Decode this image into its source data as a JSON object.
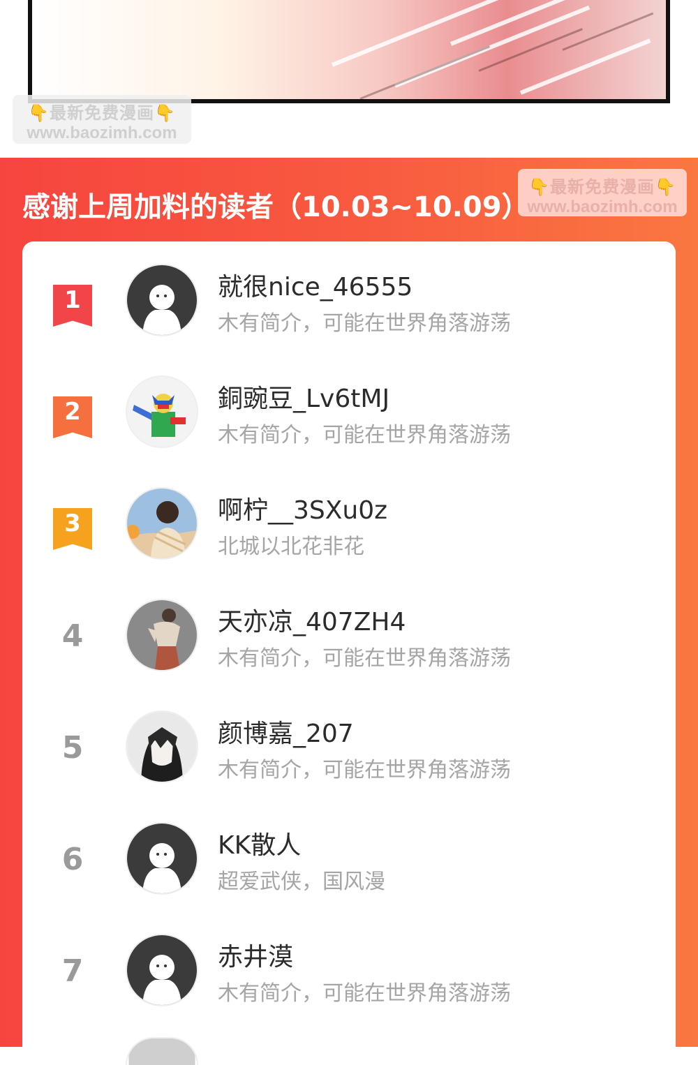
{
  "watermark": {
    "line1": "最新免费漫画",
    "line2": "www.baozimh.com"
  },
  "ranking": {
    "title": "感谢上周加料的读者（10.03~10.09）",
    "readers": [
      {
        "rank": "1",
        "name": "就很nice_46555",
        "bio": "木有简介，可能在世界角落游荡",
        "avatar": "default-avatar"
      },
      {
        "rank": "2",
        "name": "銅豌豆_Lv6tMJ",
        "bio": "木有简介，可能在世界角落游荡",
        "avatar": "robot-avatar"
      },
      {
        "rank": "3",
        "name": "啊柠__3SXu0z",
        "bio": "北城以北花非花",
        "avatar": "boy-avatar"
      },
      {
        "rank": "4",
        "name": "天亦凉_407ZH4",
        "bio": "木有简介，可能在世界角落游荡",
        "avatar": "figure-avatar"
      },
      {
        "rank": "5",
        "name": "颜博嘉_207",
        "bio": "木有简介，可能在世界角落游荡",
        "avatar": "anime-avatar"
      },
      {
        "rank": "6",
        "name": "KK散人",
        "bio": "超爱武侠，国风漫",
        "avatar": "default-avatar"
      },
      {
        "rank": "7",
        "name": "赤井漠",
        "bio": "木有简介，可能在世界角落游荡",
        "avatar": "default-avatar"
      }
    ]
  },
  "colors": {
    "rank1": "#f0464a",
    "rank2": "#f5703e",
    "rank3": "#f6a21f",
    "section_bg": "#f6453f"
  }
}
